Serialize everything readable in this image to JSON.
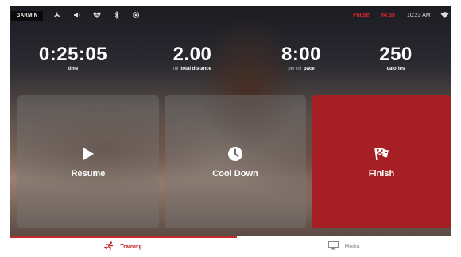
{
  "status": {
    "brand": "GARMIN",
    "icons": [
      "fan-icon",
      "volume-icon",
      "heart-rate-icon",
      "bluetooth-icon",
      "settings-icon"
    ],
    "state": "Pause",
    "paused_time": "04:35",
    "clock": "10:23 AM"
  },
  "stats": [
    {
      "value": "0:25:05",
      "unit": "",
      "label": "time"
    },
    {
      "value": "2.00",
      "unit": "mi",
      "label": "total distance"
    },
    {
      "value": "8:00",
      "unit": "per mi",
      "label": "pace"
    },
    {
      "value": "250",
      "unit": "",
      "label": "calories"
    }
  ],
  "actions": [
    {
      "label": "Resume",
      "icon": "play-icon"
    },
    {
      "label": "Cool Down",
      "icon": "clock-icon"
    },
    {
      "label": "Finish",
      "icon": "checkered-flag-icon"
    }
  ],
  "tabs": [
    {
      "label": "Training",
      "icon": "running-icon",
      "active": true
    },
    {
      "label": "Media",
      "icon": "screen-cast-icon",
      "active": false
    }
  ],
  "colors": {
    "accent": "#c0282b",
    "finish": "#a61f24"
  }
}
